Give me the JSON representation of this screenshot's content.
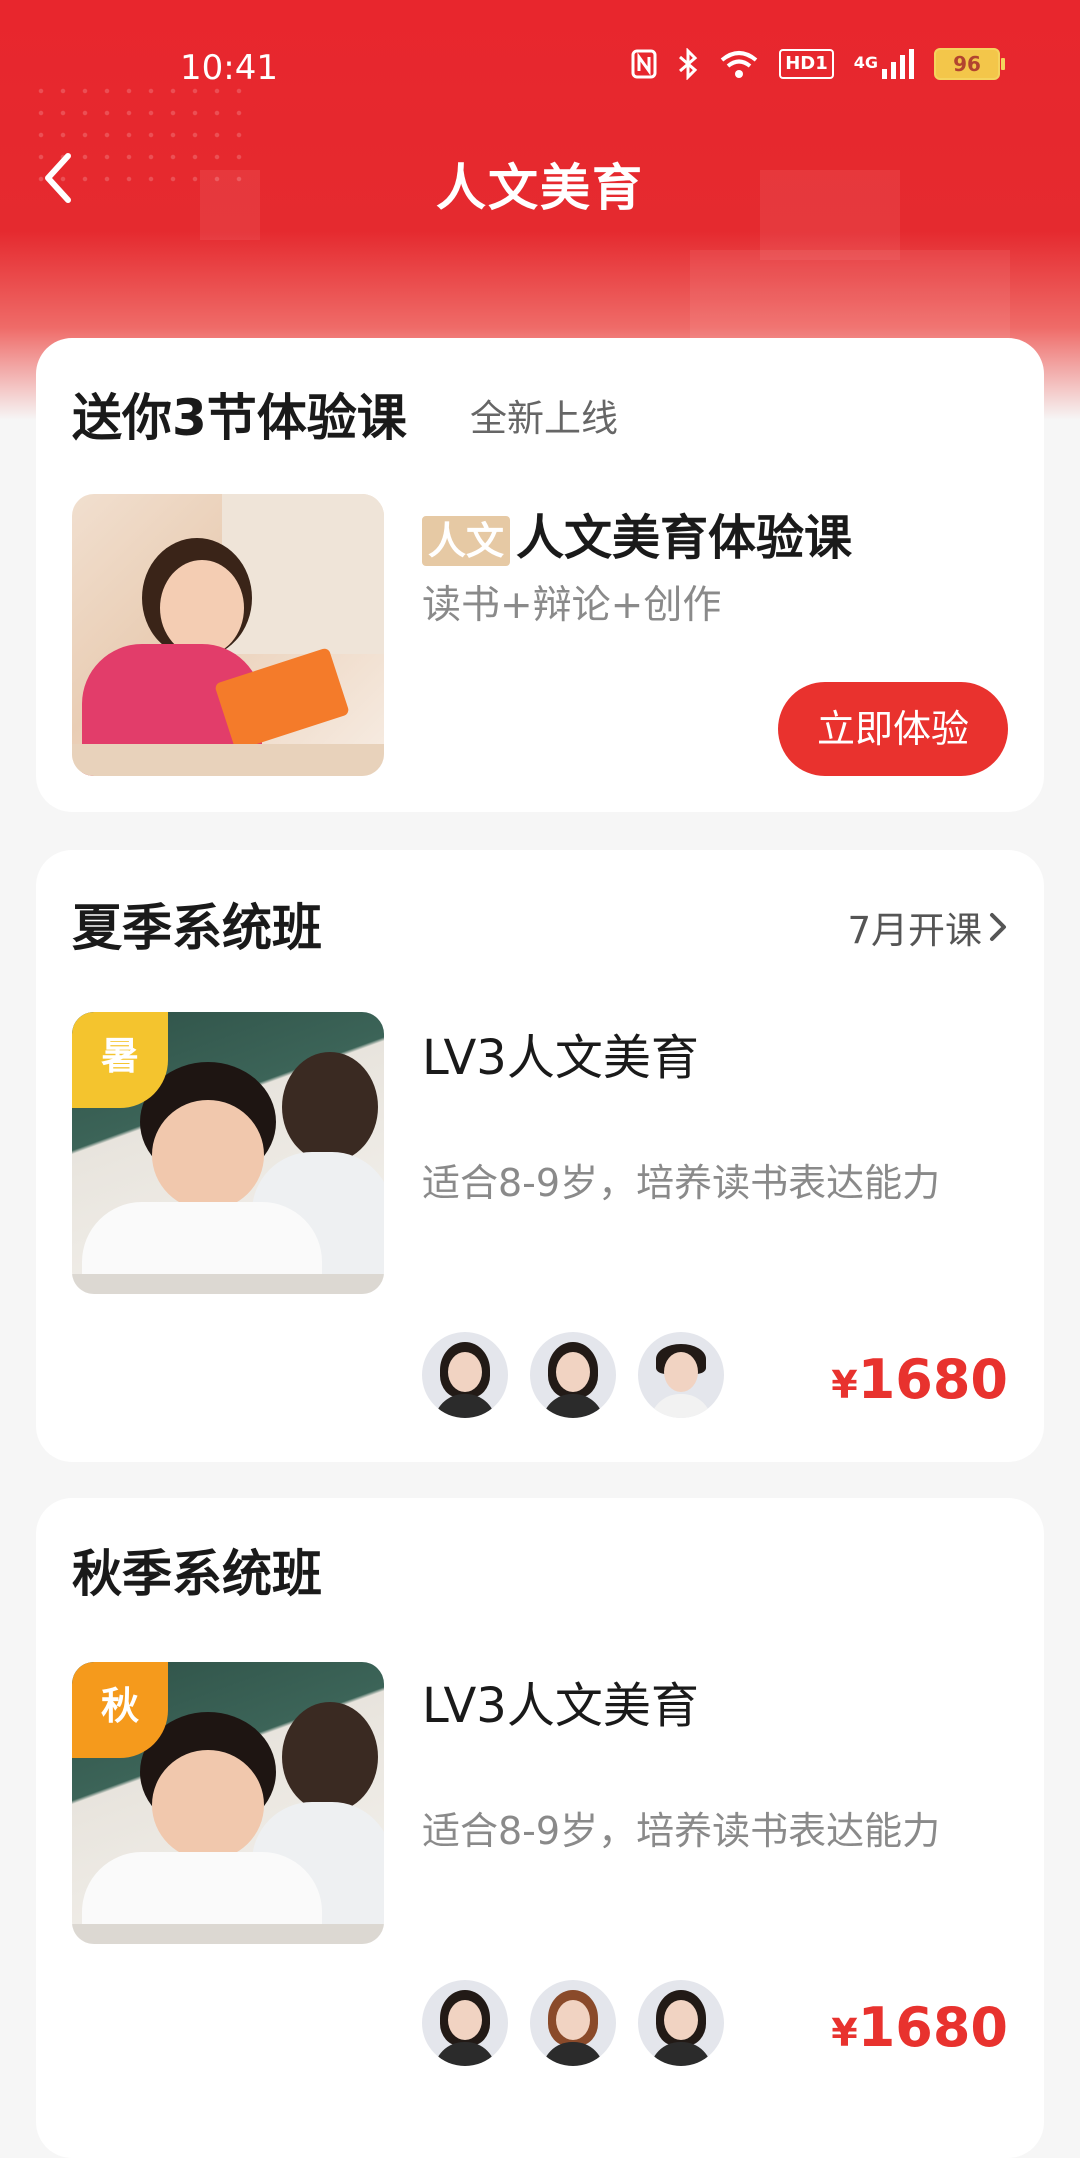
{
  "status_bar": {
    "time": "10:41",
    "hd_label": "HD1",
    "signal_label": "4G",
    "battery": "96"
  },
  "nav": {
    "title": "人文美育"
  },
  "trial": {
    "title": "送你3节体验课",
    "subtitle": "全新上线",
    "tag": "人文",
    "course_title": "人文美育体验课",
    "course_desc": "读书+辩论+创作",
    "cta": "立即体验"
  },
  "summer": {
    "title": "夏季系统班",
    "more": "7月开课",
    "badge": "暑",
    "course_title": "LV3人文美育",
    "course_desc": "适合8-9岁，培养读书表达能力",
    "price_symbol": "¥",
    "price": "1680"
  },
  "autumn": {
    "title": "秋季系统班",
    "badge": "秋",
    "course_title": "LV3人文美育",
    "course_desc": "适合8-9岁，培养读书表达能力",
    "price_symbol": "¥",
    "price": "1680"
  },
  "colors": {
    "brand_red": "#e8262d",
    "badge_summer": "#f4c42e",
    "badge_autumn": "#f59a1c",
    "tag_bg": "#e6c9a4"
  },
  "icons": {
    "back": "chevron-left-icon",
    "more": "chevron-right-icon"
  }
}
